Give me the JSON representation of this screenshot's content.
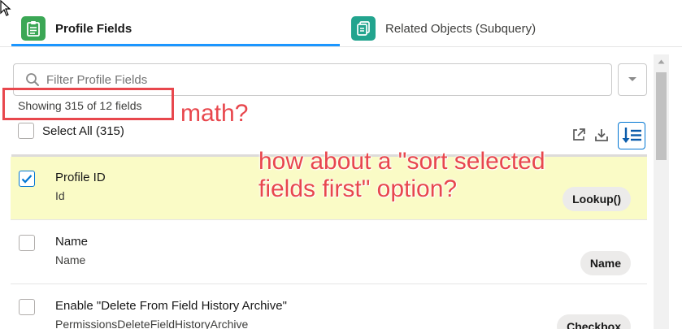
{
  "tabs": [
    {
      "label": "Profile Fields",
      "icon": "list-icon",
      "active": true
    },
    {
      "label": "Related Objects (Subquery)",
      "icon": "related-list-icon",
      "active": false
    }
  ],
  "search": {
    "value": "",
    "placeholder": "Filter Profile Fields"
  },
  "showing_text": "Showing 315 of 12 fields",
  "select_all_label": "Select All (315)",
  "toolbar": {
    "icons": [
      "pop-out-icon",
      "download-icon",
      "sort-list-icon"
    ]
  },
  "fields": [
    {
      "label": "Profile ID",
      "api_name": "Id",
      "type": "Lookup()",
      "checked": true
    },
    {
      "label": "Name",
      "api_name": "Name",
      "type": "Name",
      "checked": false
    },
    {
      "label": "Enable \"Delete From Field History Archive\"",
      "api_name": "PermissionsDeleteFieldHistoryArchive",
      "type": "Checkbox",
      "checked": false
    }
  ],
  "annotations": {
    "math": "math?",
    "sort_line1": "how about a \"sort selected",
    "sort_line2": "fields first\" option?"
  },
  "colors": {
    "accent": "#1b96ff",
    "selected_row": "#fafbc6",
    "annotation_red": "#e8474d",
    "tab_icon_green": "#3ba755",
    "tab_icon_teal": "#22a48e"
  }
}
